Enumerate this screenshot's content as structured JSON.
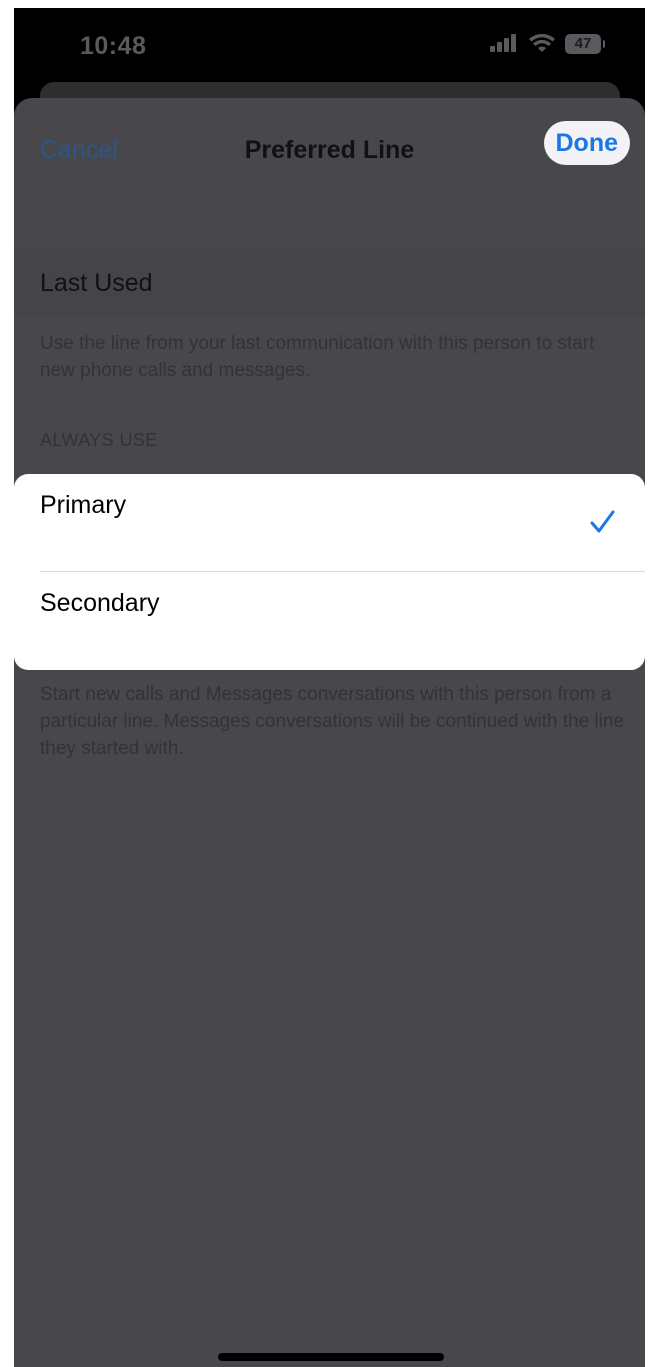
{
  "status_bar": {
    "time": "10:48",
    "battery": "47",
    "icons": [
      "cellular-signal-icon",
      "wifi-icon",
      "battery-icon"
    ]
  },
  "nav": {
    "cancel_label": "Cancel",
    "title": "Preferred Line",
    "done_label": "Done"
  },
  "last_used": {
    "label": "Last Used",
    "footer": "Use the line from your last communication with this person to start new phone calls and messages."
  },
  "always_use": {
    "header": "ALWAYS USE",
    "options": [
      {
        "label": "Primary",
        "selected": true
      },
      {
        "label": "Secondary",
        "selected": false
      }
    ],
    "footer": "Start new calls and Messages conversations with this person from a particular line. Messages conversations will be continued with the line they started with."
  },
  "colors": {
    "accent": "#1a78e6",
    "sheet_dimmed": "#48484c",
    "card": "#ffffff"
  }
}
